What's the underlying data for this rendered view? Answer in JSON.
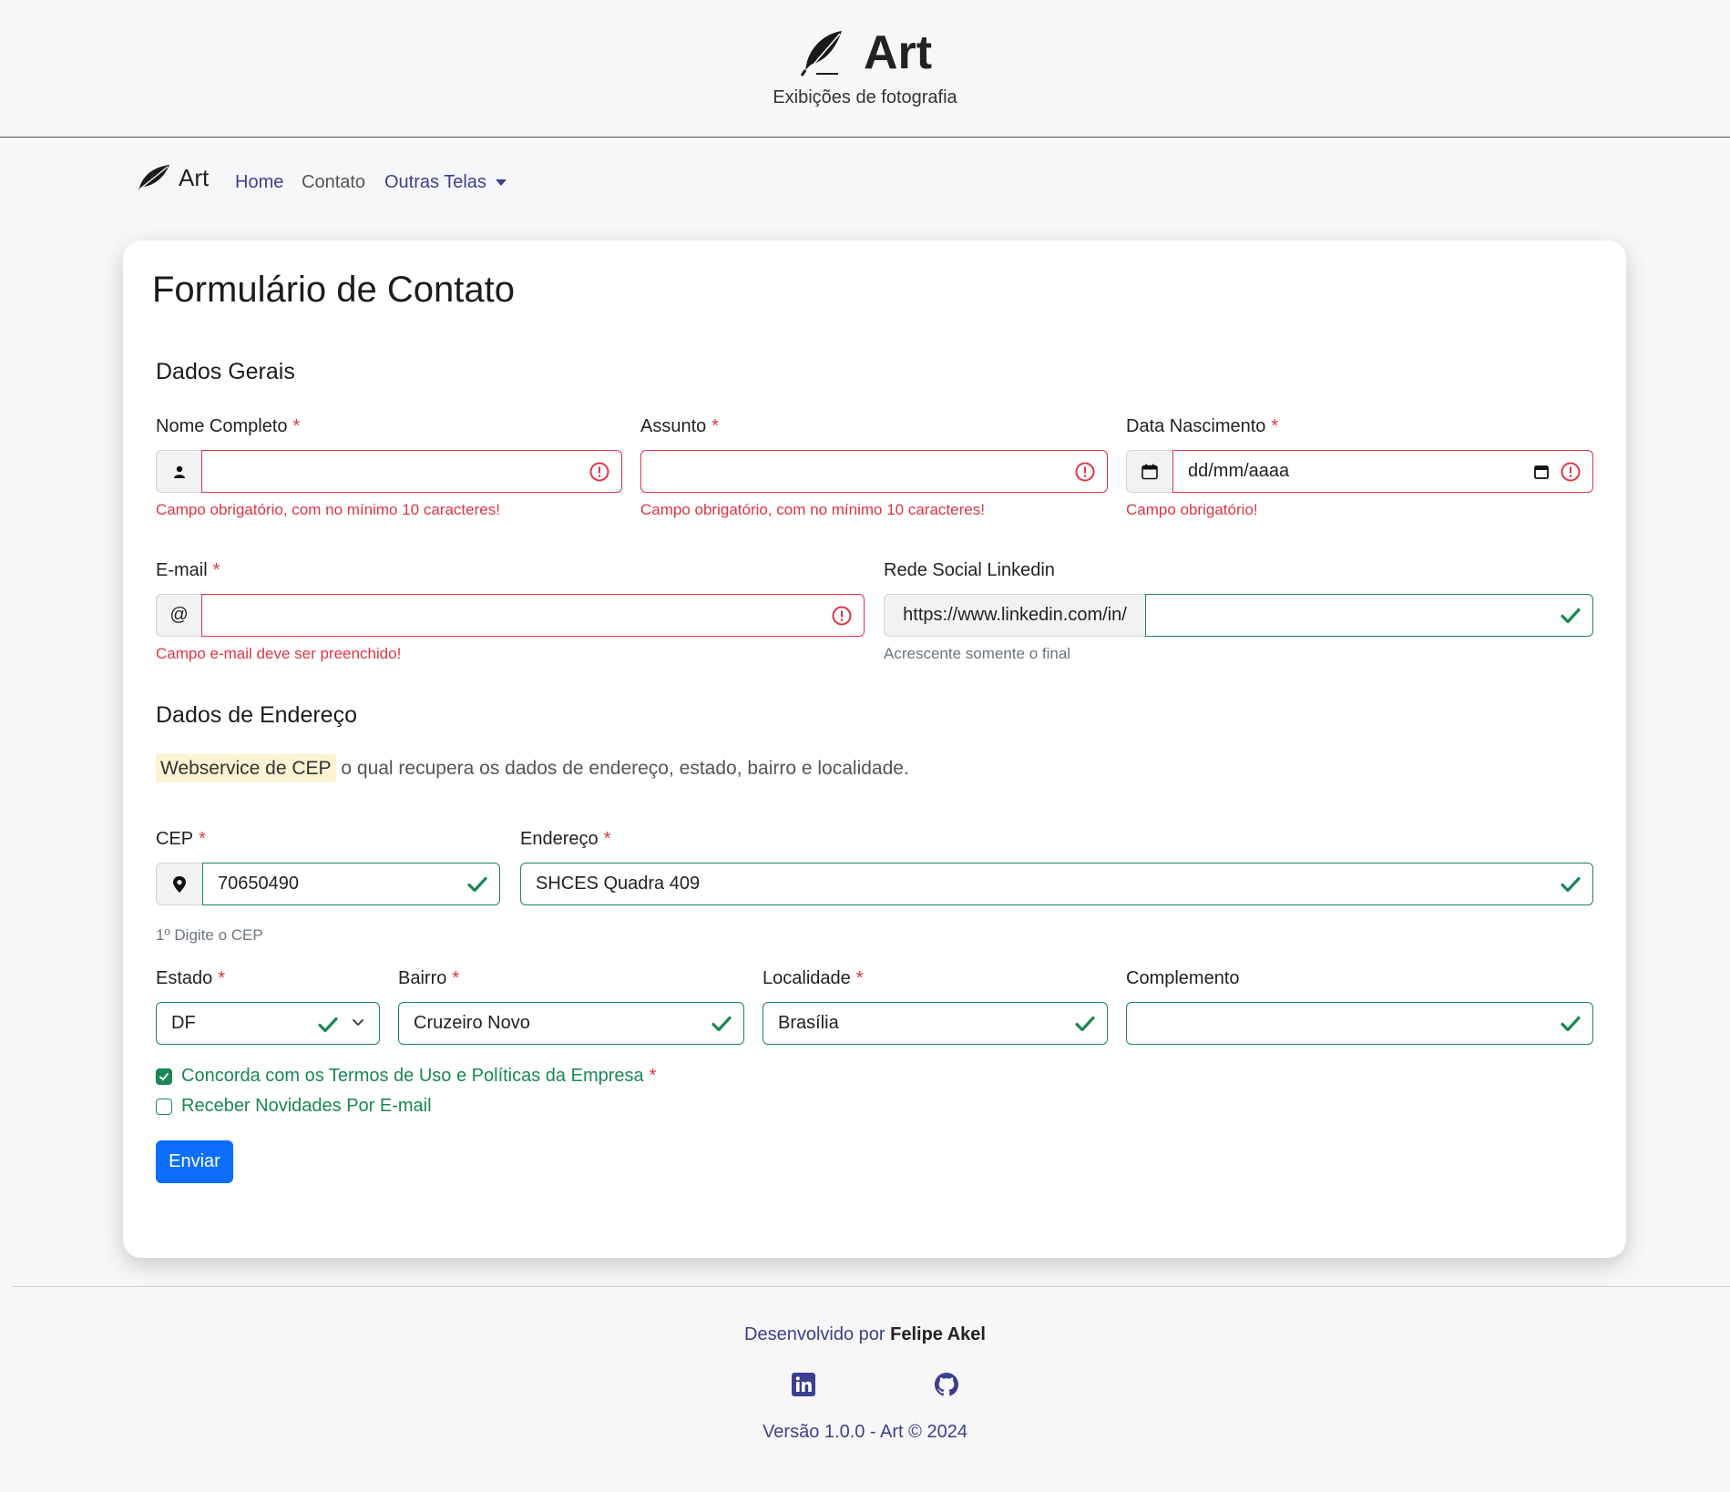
{
  "header": {
    "title": "Art",
    "subtitle": "Exibições de fotografia"
  },
  "navbar": {
    "brand": "Art",
    "links": {
      "home": "Home",
      "contato": "Contato",
      "outras": "Outras Telas"
    }
  },
  "form": {
    "title": "Formulário de Contato",
    "section_general": "Dados Gerais",
    "nome": {
      "label": "Nome Completo",
      "value": "",
      "error": "Campo obrigatório, com no mínimo 10 caracteres!"
    },
    "assunto": {
      "label": "Assunto",
      "value": "",
      "error": "Campo obrigatório, com no mínimo 10 caracteres!"
    },
    "data_nasc": {
      "label": "Data Nascimento",
      "placeholder": "dd/mm/aaaa",
      "error": "Campo obrigatório!"
    },
    "email": {
      "label": "E-mail",
      "addon": "@",
      "value": "",
      "error": "Campo e-mail deve ser preenchido!"
    },
    "linkedin": {
      "label": "Rede Social Linkedin",
      "prefix": "https://www.linkedin.com/in/",
      "value": "",
      "hint": "Acrescente somente o final"
    },
    "section_address": "Dados de Endereço",
    "cep_mark": "Webservice de CEP",
    "cep_desc": "o qual recupera os dados de endereço, estado, bairro e localidade.",
    "cep": {
      "label": "CEP",
      "value": "70650490",
      "hint": "1º Digite o CEP"
    },
    "endereco": {
      "label": "Endereço",
      "value": "SHCES Quadra 409"
    },
    "estado": {
      "label": "Estado",
      "value": "DF"
    },
    "bairro": {
      "label": "Bairro",
      "value": "Cruzeiro Novo"
    },
    "localidade": {
      "label": "Localidade",
      "value": "Brasília"
    },
    "complemento": {
      "label": "Complemento",
      "value": ""
    },
    "terms": {
      "label": "Concorda com os Termos de Uso e Políticas da Empresa",
      "checked": true
    },
    "news": {
      "label": "Receber Novidades Por E-mail",
      "checked": false
    },
    "submit": "Enviar",
    "required_mark": "*"
  },
  "footer": {
    "dev_prefix": "Desenvolvido por",
    "dev_name": "Felipe Akel",
    "version": "Versão 1.0.0 - Art © 2024"
  },
  "colors": {
    "invalid": "#dc3545",
    "valid": "#198754",
    "primary": "#0d6efd",
    "link": "#3b3f8f"
  }
}
